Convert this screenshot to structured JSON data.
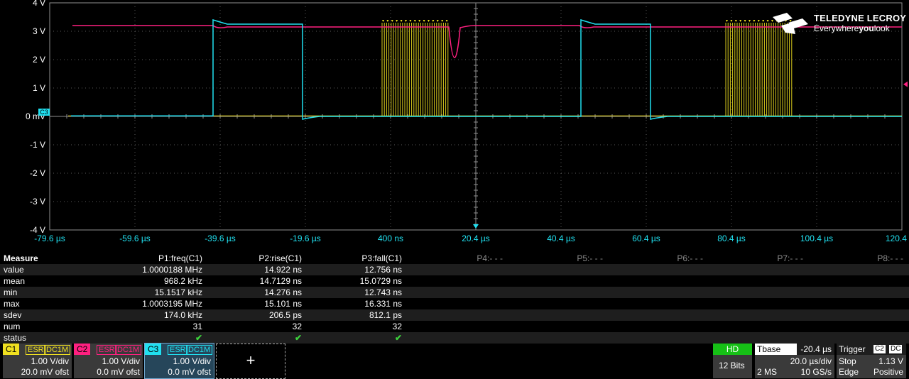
{
  "brand": {
    "name": "TELEDYNE LECROY",
    "tagline_pre": "Everywhere",
    "tagline_bold": "you",
    "tagline_post": "look"
  },
  "grid": {
    "y_labels": [
      "4 V",
      "3 V",
      "2 V",
      "1 V",
      "0 mV",
      "-1 V",
      "-2 V",
      "-3 V",
      "-4 V"
    ],
    "x_labels": [
      "-79.6 µs",
      "-59.6 µs",
      "-39.6 µs",
      "-19.6 µs",
      "400 ns",
      "20.4 µs",
      "40.4 µs",
      "60.4 µs",
      "80.4 µs",
      "100.4 µs",
      "120.4 µs"
    ],
    "ground_marker": "C3"
  },
  "colors": {
    "c1": "#f0e020",
    "c2": "#ff2080",
    "c3": "#20e0f0",
    "grid": "#5a5a5a",
    "axis": "#909090"
  },
  "measure": {
    "header": "Measure",
    "p1": "P1:freq(C1)",
    "p2": "P2:rise(C1)",
    "p3": "P3:fall(C1)",
    "p4": "P4:- - -",
    "p5": "P5:- - -",
    "p6": "P6:- - -",
    "p7": "P7:- - -",
    "p8": "P8:- - -",
    "rows": [
      {
        "label": "value",
        "p1": "1.0000188 MHz",
        "p2": "14.922 ns",
        "p3": "12.756 ns"
      },
      {
        "label": "mean",
        "p1": "968.2 kHz",
        "p2": "14.7129 ns",
        "p3": "15.0729 ns"
      },
      {
        "label": "min",
        "p1": "15.1517 kHz",
        "p2": "14.276 ns",
        "p3": "12.743 ns"
      },
      {
        "label": "max",
        "p1": "1.0003195 MHz",
        "p2": "15.101 ns",
        "p3": "16.331 ns"
      },
      {
        "label": "sdev",
        "p1": "174.0 kHz",
        "p2": "206.5 ps",
        "p3": "812.1 ps"
      },
      {
        "label": "num",
        "p1": "31",
        "p2": "32",
        "p3": "32"
      },
      {
        "label": "status",
        "p1": "✔",
        "p2": "✔",
        "p3": "✔"
      }
    ]
  },
  "channels": [
    {
      "tag": "C1",
      "esr": "ESR",
      "dc": "DC1M",
      "vdiv": "1.00 V/div",
      "ofst": "20.0 mV ofst"
    },
    {
      "tag": "C2",
      "esr": "ESR",
      "dc": "DC1M",
      "vdiv": "1.00 V/div",
      "ofst": "0.0 mV ofst"
    },
    {
      "tag": "C3",
      "esr": "ESR",
      "dc": "DC1M",
      "vdiv": "1.00 V/div",
      "ofst": "0.0 mV ofst"
    }
  ],
  "add_channel": "+",
  "hd": {
    "label": "HD",
    "bits": "12 Bits"
  },
  "timebase": {
    "label": "Tbase",
    "delay": "-20.4 µs",
    "tdiv": "20.0 µs/div",
    "points": "2 MS",
    "rate": "10 GS/s"
  },
  "trigger": {
    "label": "Trigger",
    "source": "C2",
    "coupling": "DC",
    "mode": "Stop",
    "level": "1.13 V",
    "type": "Edge",
    "slope": "Positive"
  }
}
